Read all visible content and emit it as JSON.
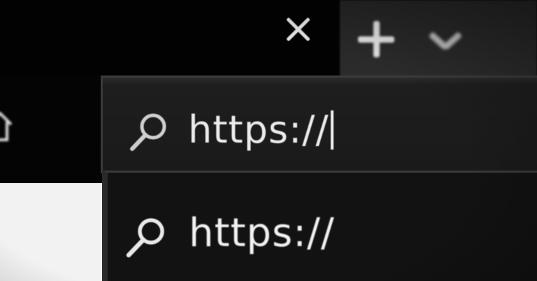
{
  "tab_strip": {
    "close_icon": "close-icon",
    "new_tab_icon": "plus-icon",
    "tab_list_icon": "chevron-down-icon"
  },
  "toolbar": {
    "home_icon": "home-icon"
  },
  "address_bar": {
    "icon": "search-icon",
    "value": "https://"
  },
  "suggestions": [
    {
      "icon": "search-icon",
      "text": "https://"
    }
  ],
  "colors": {
    "background": "#040404",
    "address_bar": "#1c1c1c",
    "dropdown": "#121212",
    "text": "#ececec",
    "new_tab_area": "#2a2a2a"
  }
}
